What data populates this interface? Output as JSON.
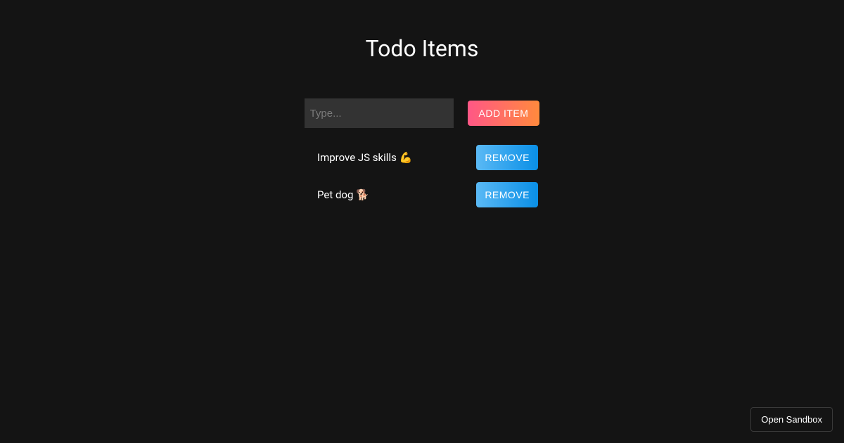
{
  "title": "Todo Items",
  "input": {
    "placeholder": "Type...",
    "value": ""
  },
  "buttons": {
    "add": "ADD ITEM",
    "remove": "REMOVE",
    "sandbox": "Open Sandbox"
  },
  "items": [
    {
      "text": "Improve JS skills 💪"
    },
    {
      "text": "Pet dog 🐕"
    }
  ]
}
